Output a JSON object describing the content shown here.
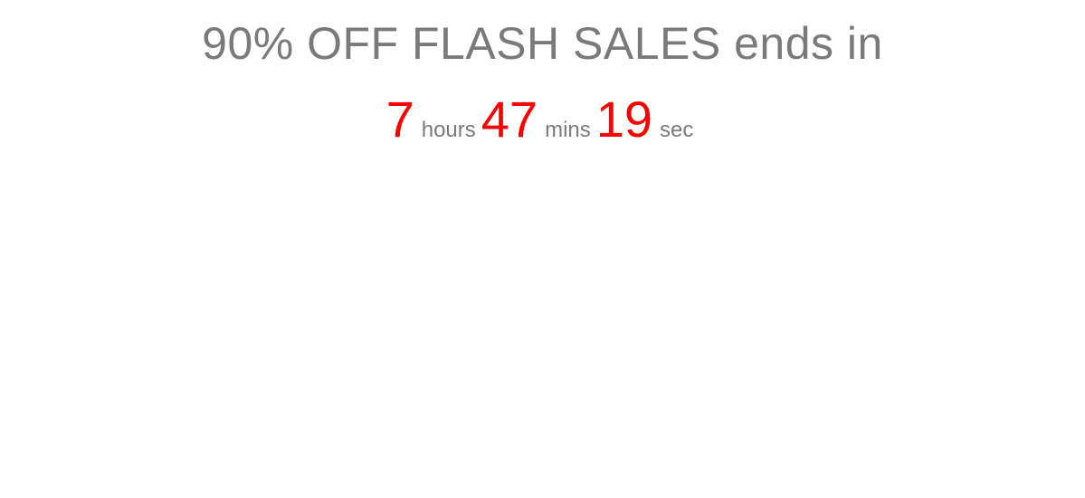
{
  "headline": "90% OFF FLASH SALES ends in",
  "countdown": {
    "hours_value": "7",
    "hours_label": "hours",
    "mins_value": "47",
    "mins_label": "mins",
    "secs_value": "19",
    "secs_label": "sec"
  },
  "colors": {
    "number": "#ff0000",
    "text": "#7a7a7a",
    "background": "#ffffff"
  }
}
